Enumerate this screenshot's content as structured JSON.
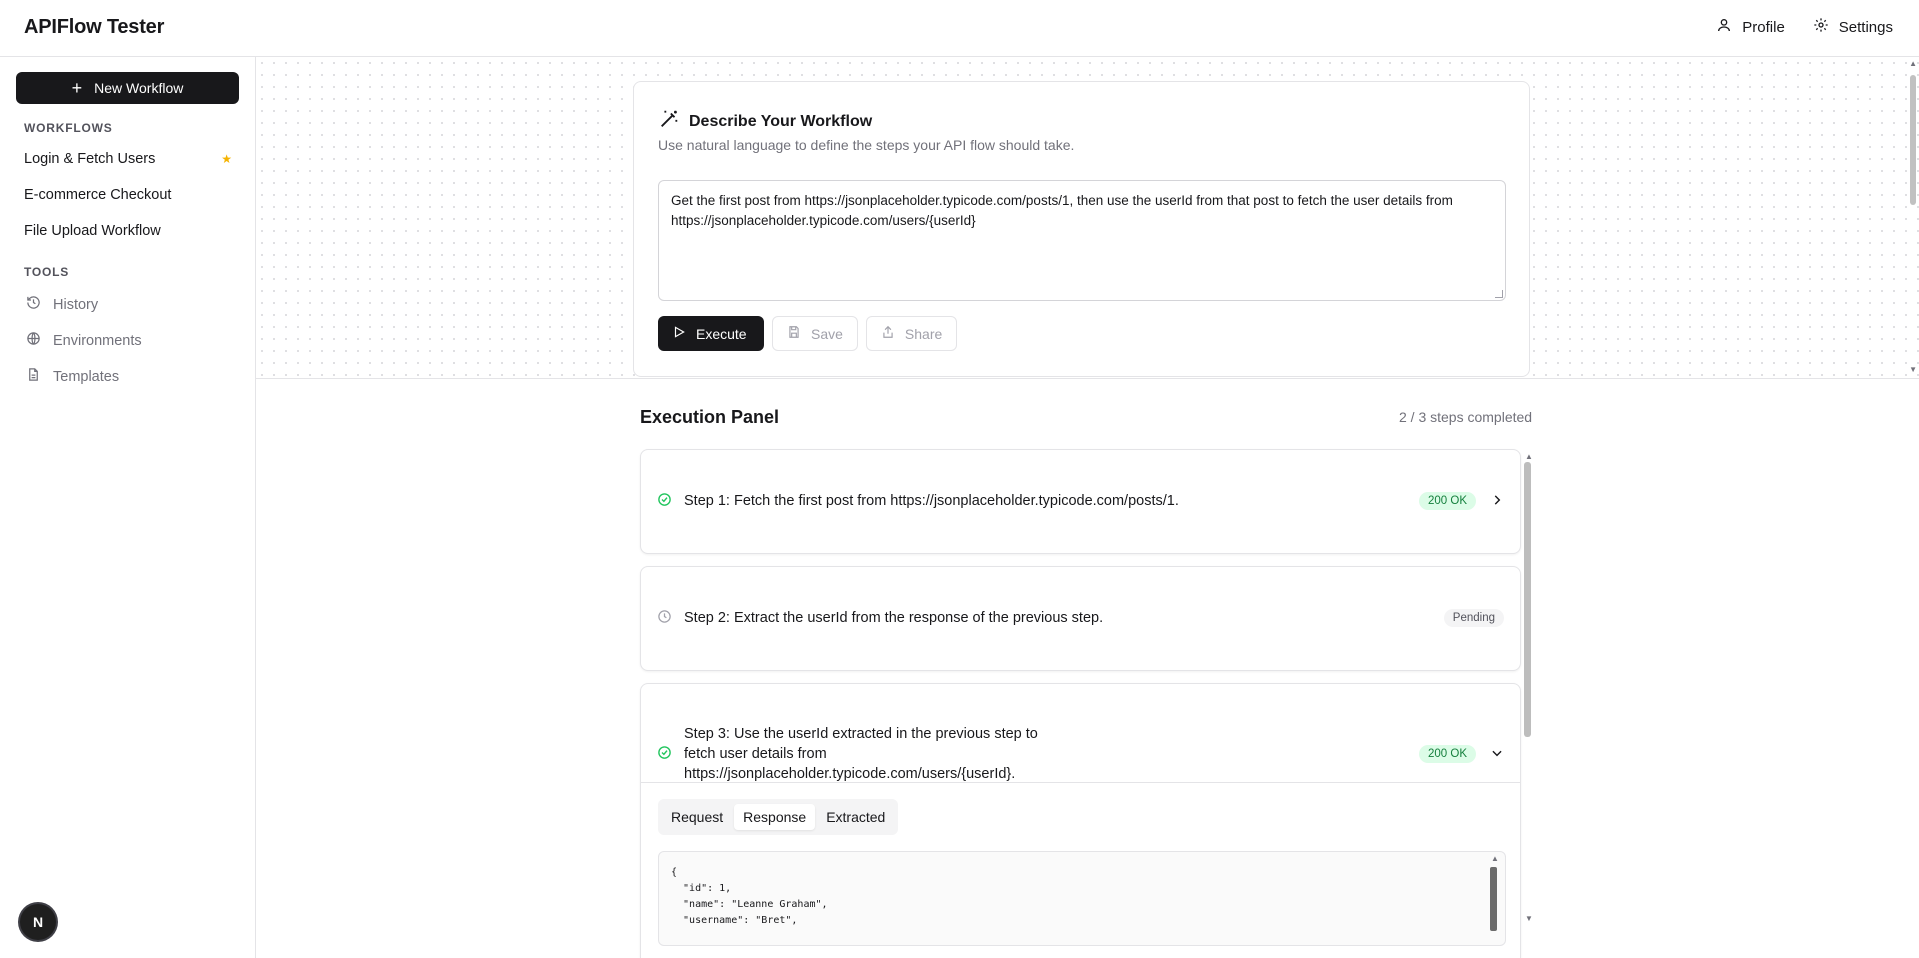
{
  "header": {
    "app_title": "APIFlow Tester",
    "profile_label": "Profile",
    "settings_label": "Settings"
  },
  "sidebar": {
    "new_workflow_label": "New Workflow",
    "workflows_heading": "WORKFLOWS",
    "workflows": [
      {
        "label": "Login & Fetch Users",
        "starred": true
      },
      {
        "label": "E-commerce Checkout",
        "starred": false
      },
      {
        "label": "File Upload Workflow",
        "starred": false
      }
    ],
    "tools_heading": "TOOLS",
    "tools": [
      {
        "label": "History",
        "icon": "history-icon"
      },
      {
        "label": "Environments",
        "icon": "globe-icon"
      },
      {
        "label": "Templates",
        "icon": "document-icon"
      }
    ],
    "badge_label": "N"
  },
  "describe": {
    "title": "Describe Your Workflow",
    "subtitle": "Use natural language to define the steps your API flow should take.",
    "prompt_text": "Get the first post from https://jsonplaceholder.typicode.com/posts/1, then use the userId from that post to fetch the user details from https://jsonplaceholder.typicode.com/users/{userId}",
    "execute_label": "Execute",
    "save_label": "Save",
    "share_label": "Share"
  },
  "execution": {
    "title": "Execution Panel",
    "status_text": "2 / 3 steps completed",
    "steps": [
      {
        "text": "Step 1: Fetch the first post from https://jsonplaceholder.typicode.com/posts/1.",
        "status": "200 OK",
        "state": "success",
        "expanded": false
      },
      {
        "text": "Step 2: Extract the userId from the response of the previous step.",
        "status": "Pending",
        "state": "pending",
        "expanded": false
      },
      {
        "text": "Step 3: Use the userId extracted in the previous step to fetch user details from https://jsonplaceholder.typicode.com/users/{userId}.",
        "status": "200 OK",
        "state": "success",
        "expanded": true
      }
    ],
    "tabs": [
      "Request",
      "Response",
      "Extracted"
    ],
    "active_tab": "Response",
    "response_body": "{\n  \"id\": 1,\n  \"name\": \"Leanne Graham\",\n  \"username\": \"Bret\","
  },
  "colors": {
    "accent_dark": "#18181b",
    "success": "#22c55e",
    "star": "#f5b301"
  }
}
